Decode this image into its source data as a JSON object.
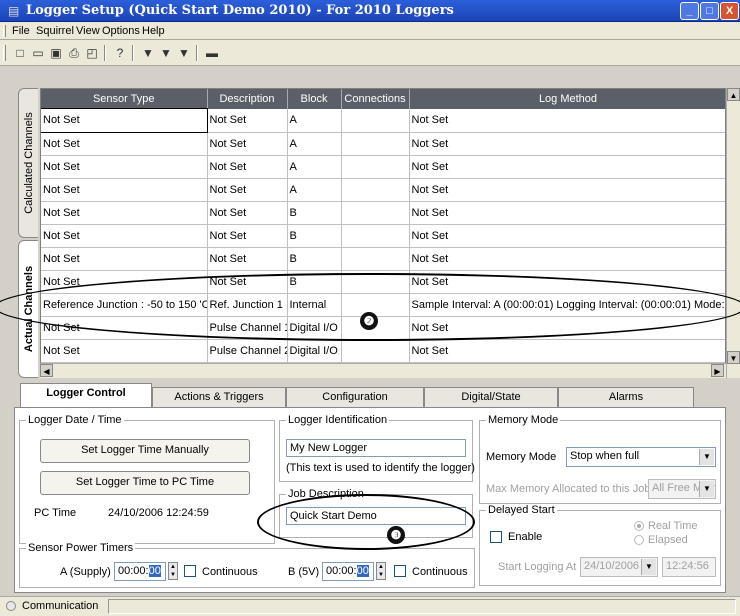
{
  "window": {
    "title": "Logger Setup (Quick Start Demo 2010) - For 2010 Loggers",
    "controls": [
      "_",
      "□",
      "X"
    ]
  },
  "menu": [
    "File",
    "Squirrel",
    "View",
    "Options",
    "Help"
  ],
  "toolbar": {
    "icons": [
      "new-icon",
      "open-icon",
      "save-icon",
      "print-icon",
      "preview-icon",
      "help-icon",
      "send-icon",
      "receive-icon",
      "download-icon",
      "terminal-icon"
    ]
  },
  "side_tabs": {
    "calculated": "Calculated Channels",
    "actual": "Actual Channels"
  },
  "grid": {
    "columns": [
      "Sensor Type",
      "Description",
      "Block",
      "Connections",
      "Log Method"
    ],
    "rows": [
      [
        "Not Set",
        "Not Set",
        "A",
        "",
        "Not Set"
      ],
      [
        "Not Set",
        "Not Set",
        "A",
        "",
        "Not Set"
      ],
      [
        "Not Set",
        "Not Set",
        "A",
        "",
        "Not Set"
      ],
      [
        "Not Set",
        "Not Set",
        "A",
        "",
        "Not Set"
      ],
      [
        "Not Set",
        "Not Set",
        "B",
        "",
        "Not Set"
      ],
      [
        "Not Set",
        "Not Set",
        "B",
        "",
        "Not Set"
      ],
      [
        "Not Set",
        "Not Set",
        "B",
        "",
        "Not Set"
      ],
      [
        "Not Set",
        "Not Set",
        "B",
        "",
        "Not Set"
      ],
      [
        "Reference  Junction : -50  to 150 'C",
        "Ref. Junction 1",
        "Internal",
        "",
        "Sample Interval: A (00:00:01) Logging Interval: (00:00:01) Mode: Inter"
      ],
      [
        "Not Set",
        "Pulse Channel 1",
        "Digital I/O",
        "",
        "Not Set"
      ],
      [
        "Not Set",
        "Pulse Channel 2",
        "Digital I/O",
        "",
        "Not Set"
      ]
    ]
  },
  "tabs": [
    "Logger Control",
    "Actions & Triggers",
    "Configuration",
    "Digital/State",
    "Alarms"
  ],
  "logger_date": {
    "legend": "Logger Date / Time",
    "set_manual": "Set Logger Time Manually",
    "set_pc": "Set Logger Time to PC Time",
    "pc_time_label": "PC Time",
    "pc_time_value": "24/10/2006 12:24:59"
  },
  "identification": {
    "legend": "Logger Identification",
    "value": "My New Logger",
    "hint": "(This text is used to identify the logger)"
  },
  "job": {
    "legend": "Job Description",
    "value": "Quick Start Demo"
  },
  "memory": {
    "legend": "Memory Mode",
    "label": "Memory Mode",
    "value": "Stop when full",
    "max_label": "Max Memory Allocated to this Job",
    "max_value": "All Free Memo"
  },
  "delayed": {
    "legend": "Delayed Start",
    "enable": "Enable",
    "real_time": "Real Time",
    "elapsed": "Elapsed",
    "start_label": "Start Logging At",
    "start_date": "24/10/2006",
    "start_time": "12:24:56"
  },
  "power": {
    "legend": "Sensor Power Timers",
    "a_label": "A (Supply)",
    "a_time": "00:00:",
    "a_sec": "00",
    "a_cont": "Continuous",
    "b_label": "B (5V)",
    "b_time": "00:00:",
    "b_sec": "00",
    "b_cont": "Continuous"
  },
  "status": {
    "label": "Communication"
  },
  "annotations": [
    "❷",
    "❸"
  ]
}
